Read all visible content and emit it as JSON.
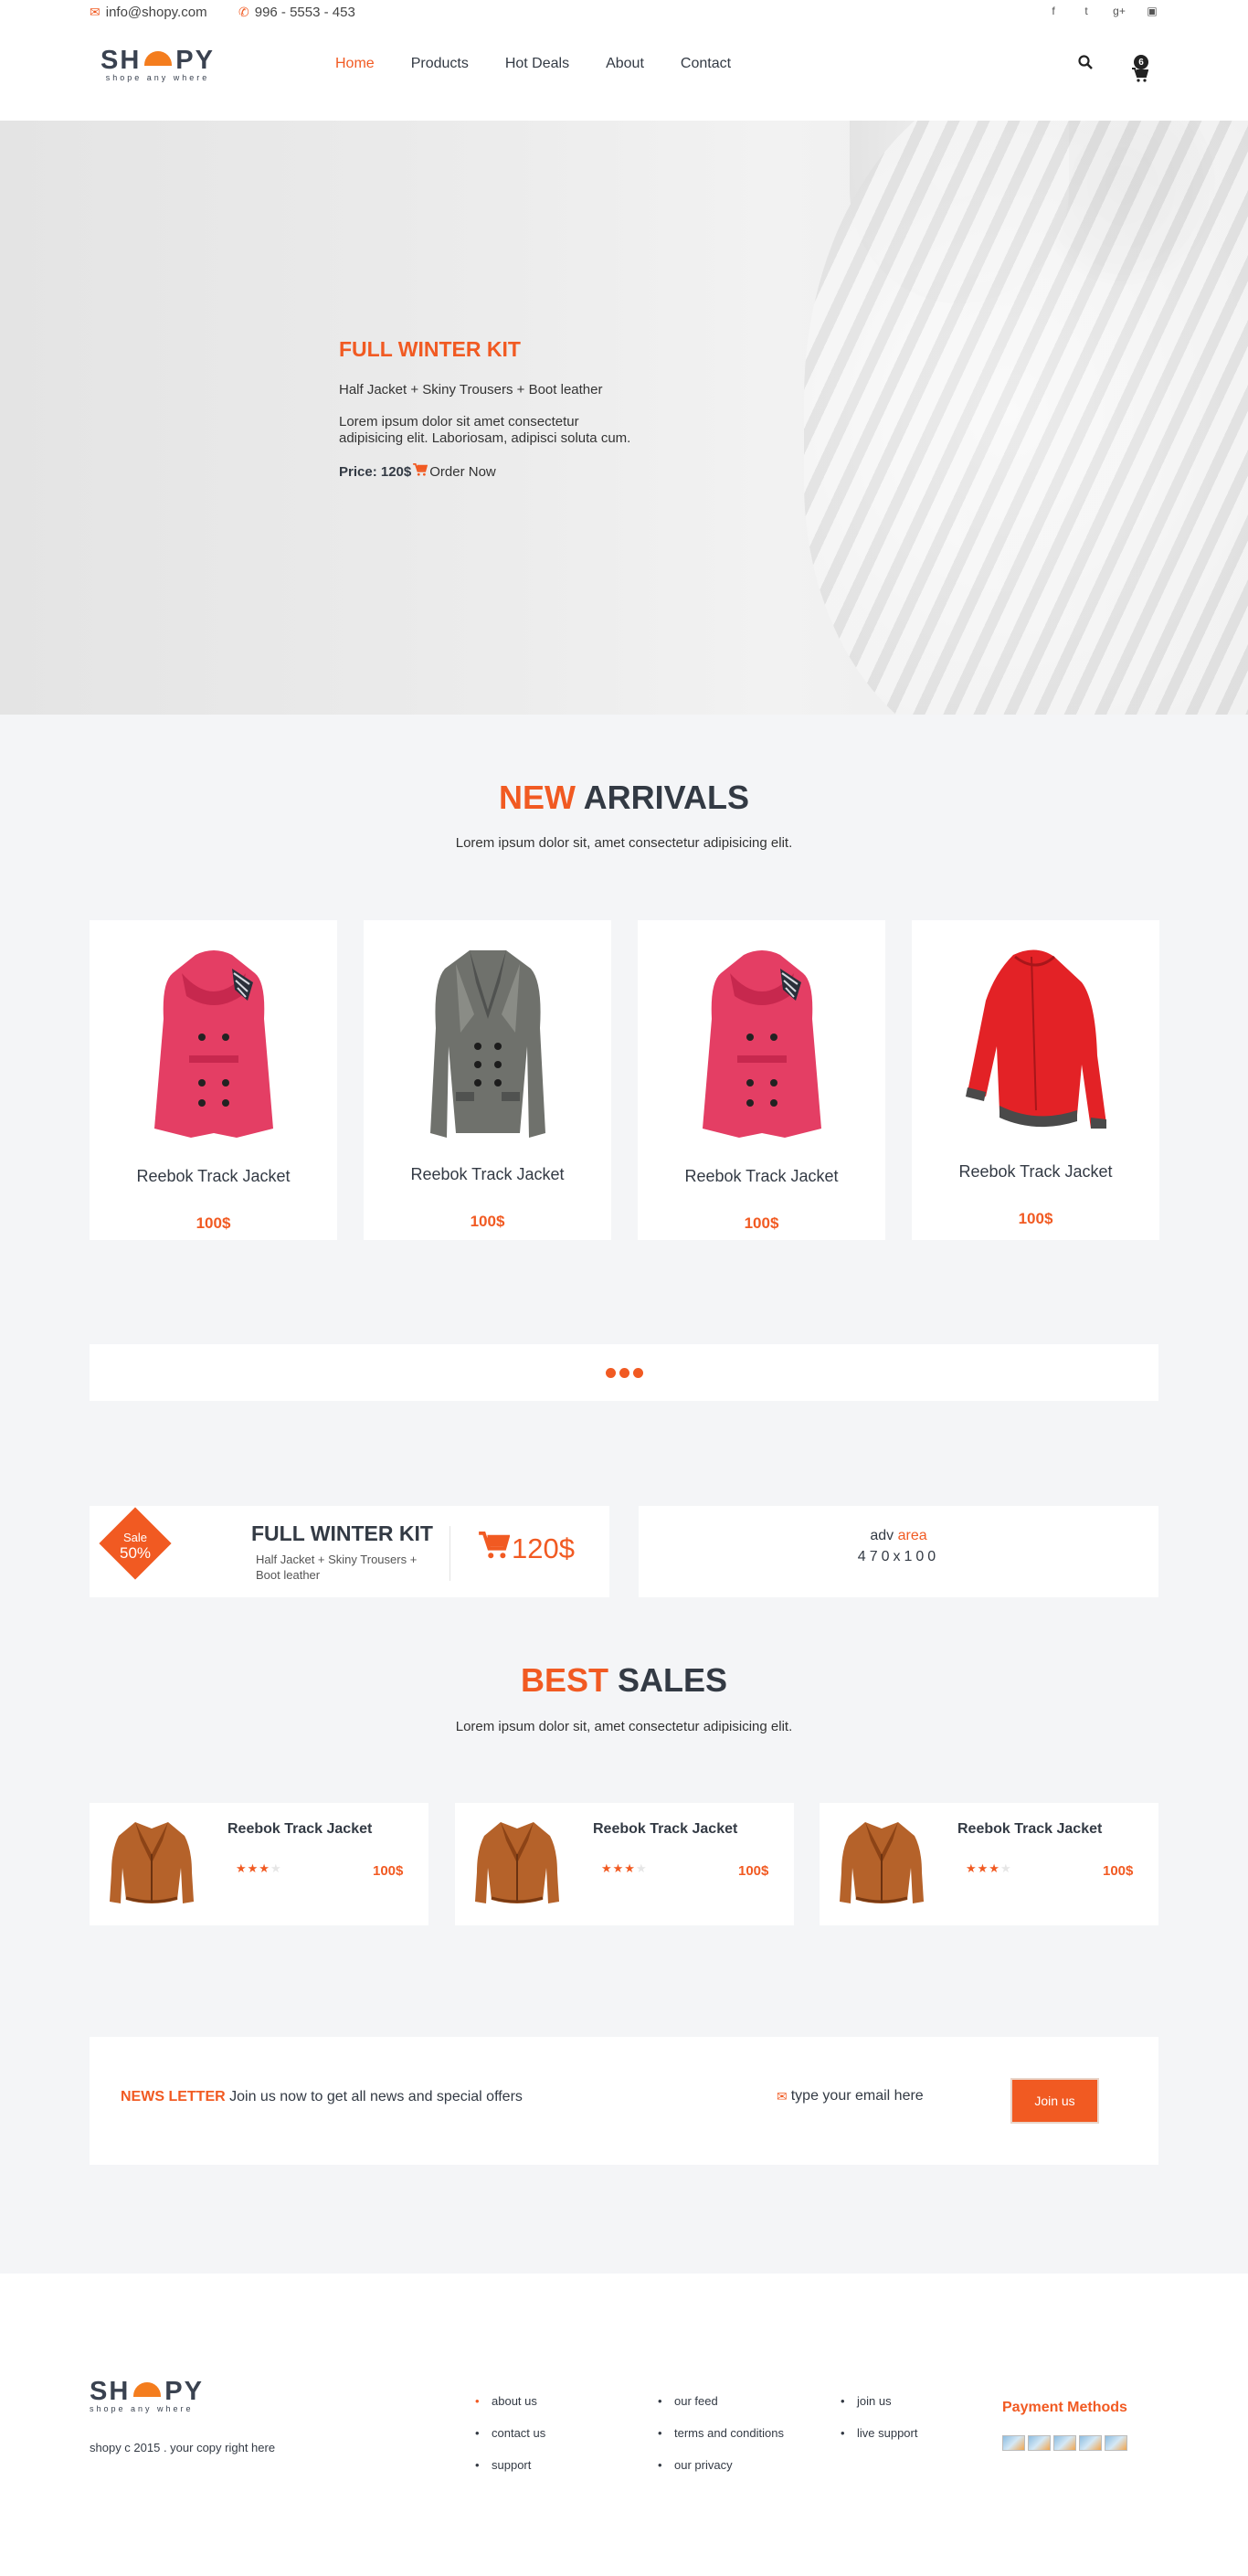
{
  "topbar": {
    "email": "info@shopy.com",
    "phone": "996 - 5553 - 453",
    "social": [
      "facebook-icon",
      "twitter-icon",
      "google-plus-icon",
      "instagram-icon"
    ]
  },
  "brand": {
    "logo_text_left": "SH",
    "logo_text_right": "PY",
    "tagline": "shope any where",
    "accent": "#f15a22"
  },
  "nav": {
    "items": [
      "Home",
      "Products",
      "Hot Deals",
      "About",
      "Contact"
    ],
    "active": "Home"
  },
  "cart": {
    "count": "6"
  },
  "hero": {
    "title": "FULL WINTER KIT",
    "subtitle": "Half Jacket + Skiny Trousers + Boot leather",
    "description": "Lorem ipsum dolor sit amet consectetur adipisicing elit. Laboriosam, adipisci soluta cum.",
    "price_label": "Price: 120$",
    "cta": "Order Now"
  },
  "arrivals": {
    "title_highlight": "NEW",
    "title_rest": "ARRIVALS",
    "subtitle": "Lorem ipsum dolor sit, amet consectetur adipisicing elit.",
    "products": [
      {
        "name": "Reebok Track Jacket",
        "price": "100$",
        "image": "pink-coat"
      },
      {
        "name": "Reebok Track Jacket",
        "price": "100$",
        "image": "grey-coat"
      },
      {
        "name": "Reebok Track Jacket",
        "price": "100$",
        "image": "pink-coat"
      },
      {
        "name": "Reebok Track Jacket",
        "price": "100$",
        "image": "red-jacket"
      }
    ]
  },
  "promo": {
    "badge_line1": "Sale",
    "badge_line2": "50%",
    "title": "FULL WINTER KIT",
    "description": "Half Jacket + Skiny Trousers + Boot leather",
    "price": "120$"
  },
  "adv": {
    "label": "adv",
    "label_highlight": "area",
    "size": "470x100"
  },
  "best_sales": {
    "title_highlight": "BEST",
    "title_rest": "SALES",
    "subtitle": "Lorem ipsum dolor sit, amet consectetur adipisicing elit.",
    "products": [
      {
        "name": "Reebok Track Jacket",
        "price": "100$",
        "rating": 3,
        "max_rating": 4
      },
      {
        "name": "Reebok Track Jacket",
        "price": "100$",
        "rating": 3,
        "max_rating": 4
      },
      {
        "name": "Reebok Track Jacket",
        "price": "100$",
        "rating": 3,
        "max_rating": 4
      }
    ]
  },
  "newsletter": {
    "label": "NEWS LETTER",
    "text": "Join us now to get all news and special offers",
    "placeholder": "type your email here",
    "button": "Join us"
  },
  "footer": {
    "copyright": "shopy c 2015 . your copy right here",
    "col1": [
      "about us",
      "contact us",
      "support"
    ],
    "col2": [
      "our feed",
      "terms and conditions",
      "our privacy"
    ],
    "col3": [
      "join us",
      "live support"
    ],
    "payment_title": "Payment Methods",
    "payment_icons": [
      "payment-card-icon",
      "payment-card-icon",
      "payment-card-icon",
      "payment-card-icon",
      "payment-card-icon"
    ]
  }
}
